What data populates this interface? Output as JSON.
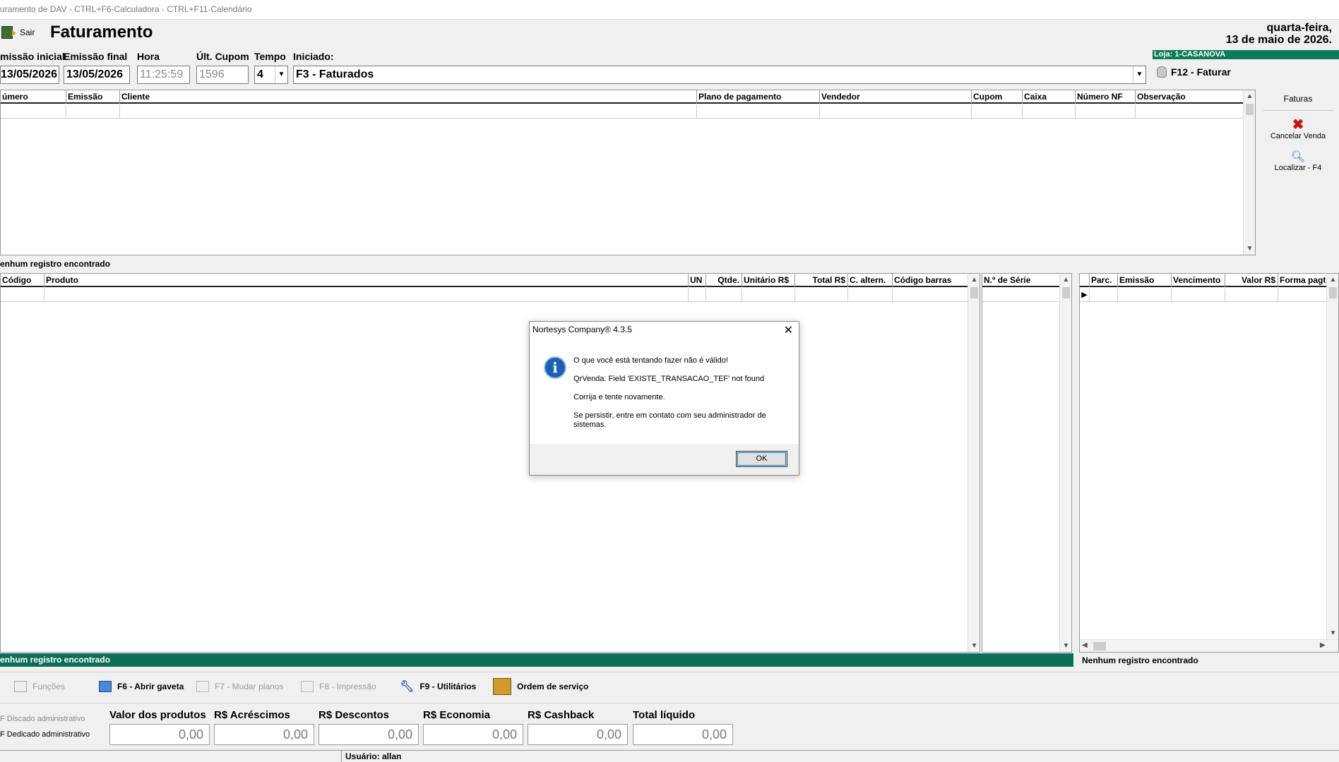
{
  "window_title": "uramento de DAV -  CTRL+F6-Calculadora - CTRL+F11-Calendário",
  "toolbar": {
    "exit_label": "Sair",
    "page_title": "Faturamento",
    "weekday": "quarta-feira,",
    "date_long": "13 de maio de 2026."
  },
  "filters": {
    "emissao_inicial_label": "missão inicial",
    "emissao_inicial_value": "13/05/2026",
    "emissao_final_label": "Emissão final",
    "emissao_final_value": "13/05/2026",
    "hora_label": "Hora",
    "hora_value": "11:25:59",
    "ult_cupom_label": "Últ. Cupom",
    "ult_cupom_value": "1596",
    "tempo_label": "Tempo",
    "tempo_value": "4",
    "iniciado_label": "Iniciado:",
    "iniciado_value": "F3 - Faturados"
  },
  "loja": "Loja: 1-CASANOVA",
  "faturar_label": "F12 - Faturar",
  "invoices_grid": {
    "columns": [
      "úmero",
      "Emissão",
      "Cliente",
      "Plano de pagamento",
      "Vendedor",
      "Cupom",
      "Caixa",
      "Número NF",
      "Observação"
    ],
    "status": "enhum registro encontrado"
  },
  "side_panel": {
    "title": "Faturas",
    "cancel_label": "Cancelar Venda",
    "find_label": "Localizar - F4"
  },
  "items_grid": {
    "columns": [
      "Código",
      "Produto",
      "UN",
      "Qtde.",
      "Unitário R$",
      "Total R$",
      "C. altern.",
      "Código barras"
    ],
    "status": "enhum registro encontrado"
  },
  "serial_grid": {
    "columns": [
      "N.º de Série"
    ]
  },
  "installments_grid": {
    "columns": [
      "Parc.",
      "Emissão",
      "Vencimento",
      "Valor R$",
      "Forma pagto"
    ],
    "status": "Nenhum registro encontrado"
  },
  "functions": [
    {
      "label": "Funções",
      "enabled": false
    },
    {
      "label": "F6 - Abrir gaveta",
      "enabled": true
    },
    {
      "label": "F7 - Mudar planos",
      "enabled": false
    },
    {
      "label": "F8 - Impressão",
      "enabled": false
    },
    {
      "label": "F9 - Utilitários",
      "enabled": true
    },
    {
      "label": "Ordem de serviço",
      "enabled": true
    }
  ],
  "modes": {
    "discado": "F Discado administrativo",
    "dedicado": "F Dedicado administrativo"
  },
  "totals": [
    {
      "label": "Valor dos produtos",
      "value": "0,00"
    },
    {
      "label": "R$ Acréscimos",
      "value": "0,00"
    },
    {
      "label": "R$ Descontos",
      "value": "0,00"
    },
    {
      "label": "R$ Economia",
      "value": "0,00"
    },
    {
      "label": "R$ Cashback",
      "value": "0,00"
    },
    {
      "label": "Total líquido",
      "value": "0,00"
    }
  ],
  "user": "Usuário: allan",
  "dialog": {
    "title": "Nortesys Company® 4.3.5",
    "line1": "O que você está tentando fazer não é válido!",
    "line2": "QrVenda: Field 'EXISTE_TRANSACAO_TEF' not found",
    "line3": "Corrija e tente novamente.",
    "line4": "Se persistir, entre em contato com seu administrador de sistemas.",
    "ok": "OK"
  },
  "colors": {
    "accent_green": "#0b6e57",
    "loja_green": "#0e7a5a"
  }
}
